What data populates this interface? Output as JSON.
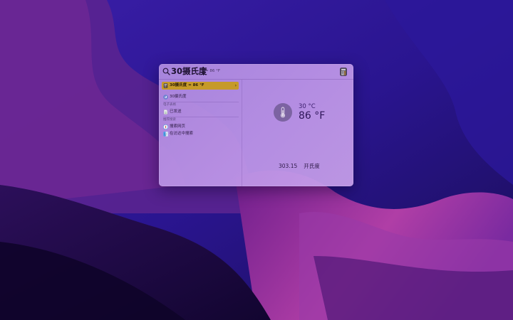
{
  "colors": {
    "selection": "#c69a2a",
    "panel": "#b88fe4",
    "desktop_base": "#2a1470"
  },
  "search": {
    "query": "30摄氏度",
    "inline_completion": "= 86 °F",
    "right_icon": "calculator-icon"
  },
  "results": {
    "top_hit": {
      "label": "30摄氏度 = 86 °F",
      "icon": "calculator-icon"
    },
    "items": [
      {
        "label": "30摄氏度",
        "icon": "conversion-icon"
      }
    ],
    "sections": [
      {
        "header": "电子表格",
        "items": [
          {
            "label": "已发送",
            "icon": "document-icon"
          }
        ]
      },
      {
        "header": "推荐搜索",
        "items": [
          {
            "label": "搜索网页",
            "icon": "safari-icon"
          },
          {
            "label": "在访达中搜索",
            "icon": "finder-icon"
          }
        ]
      }
    ]
  },
  "detail": {
    "icon": "thermometer-icon",
    "from_value": "30 °C",
    "to_value": "86 °F",
    "kelvin_value": "303.15",
    "kelvin_unit": "开氏度"
  }
}
